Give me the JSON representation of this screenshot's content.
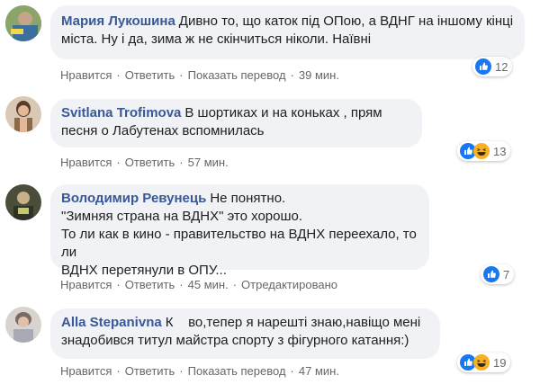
{
  "comments": [
    {
      "author": "Мария Лукошина",
      "text": "Дивно то, що каток під ОПою, а ВДНГ на іншому кінці міста. Ну і да, зима ж не скінчиться ніколи. Наївні",
      "actions": {
        "like": "Нравится",
        "reply": "Ответить",
        "translate": "Показать перевод",
        "time": "39 мин."
      },
      "reactions": {
        "count": "12",
        "types": [
          "like-icon"
        ]
      }
    },
    {
      "author": "Svitlana Trofimova",
      "text": "В шортиках и на коньках , прям песня о Лабутенах вспомнилась",
      "actions": {
        "like": "Нравится",
        "reply": "Ответить",
        "time": "57 мин."
      },
      "reactions": {
        "count": "13",
        "types": [
          "like-icon",
          "laugh-icon"
        ]
      }
    },
    {
      "author": "Володимир Ревунець",
      "text_lines": [
        "Не понятно.",
        "\"Зимняя страна на ВДНХ\" это хорошо.",
        "То ли как в кино - правительство на ВДНХ переехало, то ли",
        "ВДНХ перетянули в ОПУ..."
      ],
      "actions": {
        "like": "Нравится",
        "reply": "Ответить",
        "time": "45 мин.",
        "edited": "Отредактировано"
      },
      "reactions": {
        "count": "7",
        "types": [
          "like-icon"
        ]
      }
    },
    {
      "author": "Alla Stepanivna",
      "text_lines": [
        "К    во,тепер я нарешті знаю,навіщо мені",
        "знадобився титул майстра спорту з фігурного катання:)"
      ],
      "actions": {
        "like": "Нравится",
        "reply": "Ответить",
        "translate": "Показать перевод",
        "time": "47 мин."
      },
      "reactions": {
        "count": "19",
        "types": [
          "like-icon",
          "laugh-icon"
        ]
      }
    }
  ],
  "colors": {
    "author": "#385898",
    "bubble": "#f0f2f5",
    "meta": "#65676b",
    "like": "#1877f2",
    "laugh": "#f7b125"
  }
}
